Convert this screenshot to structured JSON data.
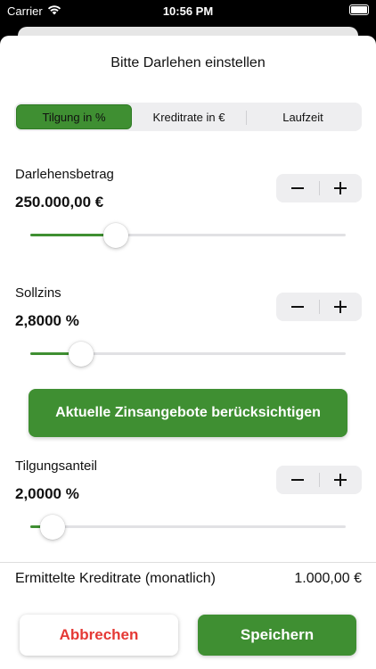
{
  "status_bar": {
    "carrier": "Carrier",
    "time": "10:56 PM",
    "icons": [
      "wifi-icon",
      "battery-icon"
    ]
  },
  "sheet": {
    "title": "Bitte Darlehen einstellen"
  },
  "segmented": {
    "selected": 0,
    "items": [
      {
        "label": "Tilgung in %"
      },
      {
        "label": "Kreditrate in €"
      },
      {
        "label": "Laufzeit"
      }
    ]
  },
  "loan_amount": {
    "label": "Darlehensbetrag",
    "value": "250.000,00 €",
    "slider_fraction": 0.27
  },
  "interest": {
    "label": "Sollzins",
    "value": "2,8000 %",
    "slider_fraction": 0.16
  },
  "offers_button": {
    "label": "Aktuelle Zinsangebote berücksichtigen"
  },
  "repayment": {
    "label": "Tilgungsanteil",
    "value": "2,0000 %",
    "slider_fraction": 0.07
  },
  "result": {
    "label": "Ermittelte Kreditrate (monatlich)",
    "value": "1.000,00 €"
  },
  "actions": {
    "cancel_label": "Abbrechen",
    "save_label": "Speichern"
  },
  "colors": {
    "accent": "#3f8f32",
    "cancel_text": "#e53935"
  }
}
